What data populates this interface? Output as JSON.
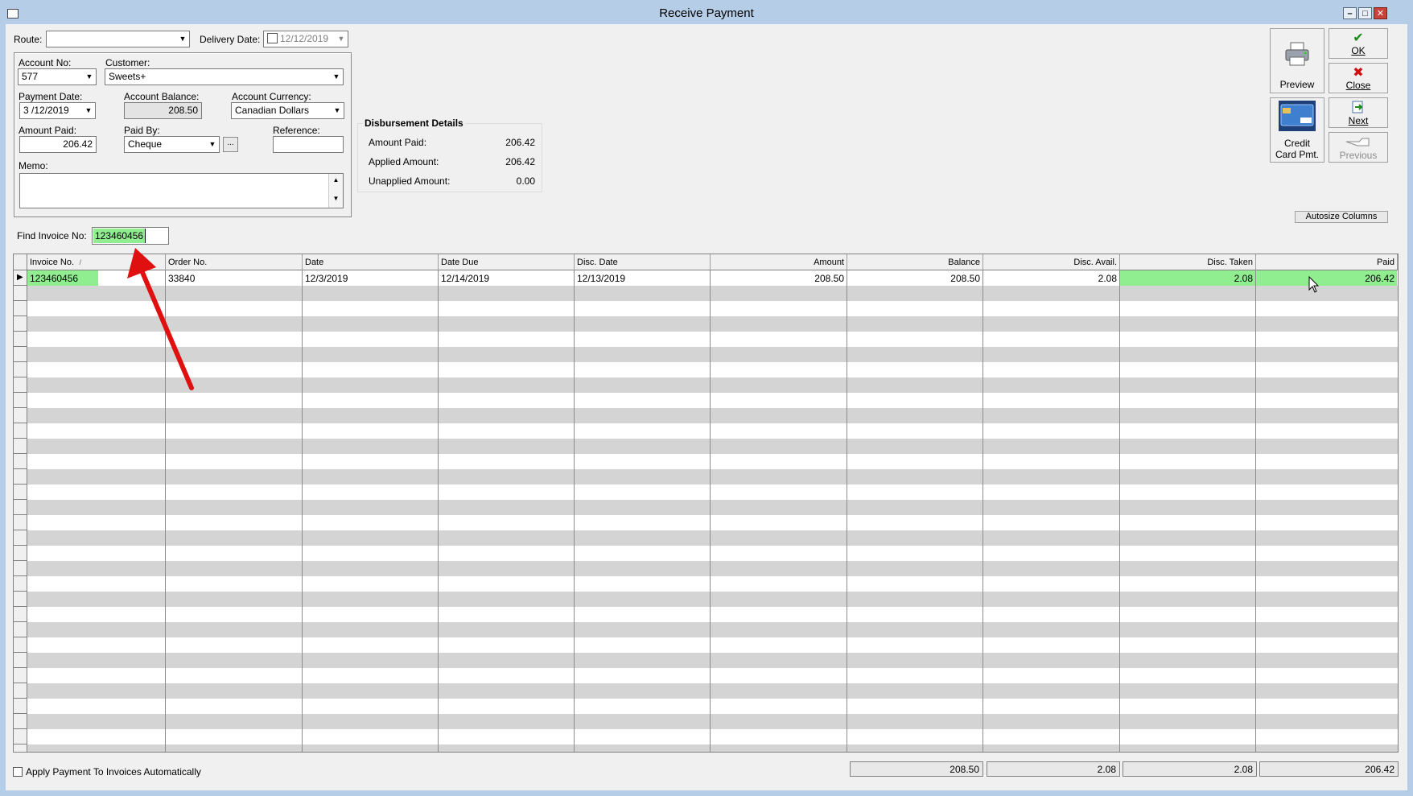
{
  "window": {
    "title": "Receive Payment"
  },
  "route": {
    "label": "Route:",
    "value": ""
  },
  "delivery_date": {
    "label": "Delivery Date:",
    "value": "12/12/2019"
  },
  "account": {
    "account_no_label": "Account No:",
    "account_no": "577",
    "customer_label": "Customer:",
    "customer": "Sweets+",
    "payment_date_label": "Payment Date:",
    "payment_date": "3 /12/2019",
    "account_balance_label": "Account Balance:",
    "account_balance": "208.50",
    "account_currency_label": "Account Currency:",
    "account_currency": "Canadian Dollars",
    "amount_paid_label": "Amount Paid:",
    "amount_paid": "206.42",
    "paid_by_label": "Paid By:",
    "paid_by": "Cheque",
    "paid_by_more": "...",
    "reference_label": "Reference:",
    "reference": "",
    "memo_label": "Memo:",
    "memo": ""
  },
  "disbursement": {
    "title": "Disbursement Details",
    "amount_paid_label": "Amount Paid:",
    "amount_paid": "206.42",
    "applied_label": "Applied Amount:",
    "applied": "206.42",
    "unapplied_label": "Unapplied Amount:",
    "unapplied": "0.00"
  },
  "toolbar": {
    "preview": "Preview",
    "ok": "OK",
    "close": "Close",
    "next": "Next",
    "previous": "Previous",
    "credit_line1": "Credit",
    "credit_line2": "Card Pmt.",
    "autosize": "Autosize Columns"
  },
  "find": {
    "label": "Find Invoice No:",
    "value": "123460456"
  },
  "grid": {
    "columns": [
      "Invoice No.",
      "Order No.",
      "Date",
      "Date Due",
      "Disc. Date",
      "Amount",
      "Balance",
      "Disc. Avail.",
      "Disc. Taken",
      "Paid"
    ],
    "sort_indicator": "/",
    "rows": [
      [
        "123460456",
        "33840",
        "12/3/2019",
        "12/14/2019",
        "12/13/2019",
        "208.50",
        "208.50",
        "2.08",
        "2.08",
        "206.42"
      ]
    ]
  },
  "footer": {
    "auto_apply_label": "Apply Payment To Invoices Automatically",
    "auto_apply_checked": false,
    "totals": [
      "208.50",
      "2.08",
      "2.08",
      "206.42"
    ]
  },
  "colors": {
    "highlight": "#90ee90",
    "titlebar": "#b6cde7",
    "annotation_arrow": "#e01010"
  },
  "icons": [
    "printer-icon",
    "checkmark-icon",
    "x-icon",
    "next-page-icon",
    "previous-hand-icon",
    "credit-card-icon"
  ]
}
